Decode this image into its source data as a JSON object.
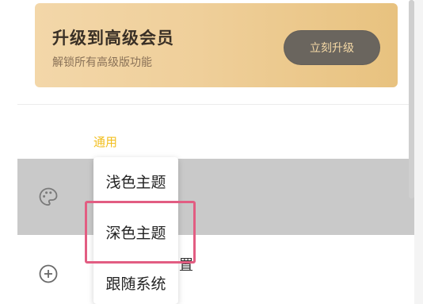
{
  "banner": {
    "title": "升级到高级会员",
    "subtitle": "解锁所有高级版功能",
    "button_label": "立刻升级"
  },
  "section": {
    "label": "通用"
  },
  "theme_menu": {
    "options": [
      "浅色主题",
      "深色主题",
      "跟随系统"
    ],
    "highlighted_option": "深色主题"
  },
  "partial_text": "置",
  "icons": [
    "palette-icon",
    "plus-circle-icon"
  ],
  "colors": {
    "accent_yellow": "#f2bf1f",
    "banner_gold": "#efcf9a",
    "button_dark": "#6a655e",
    "highlight_pink": "#e25d82"
  }
}
